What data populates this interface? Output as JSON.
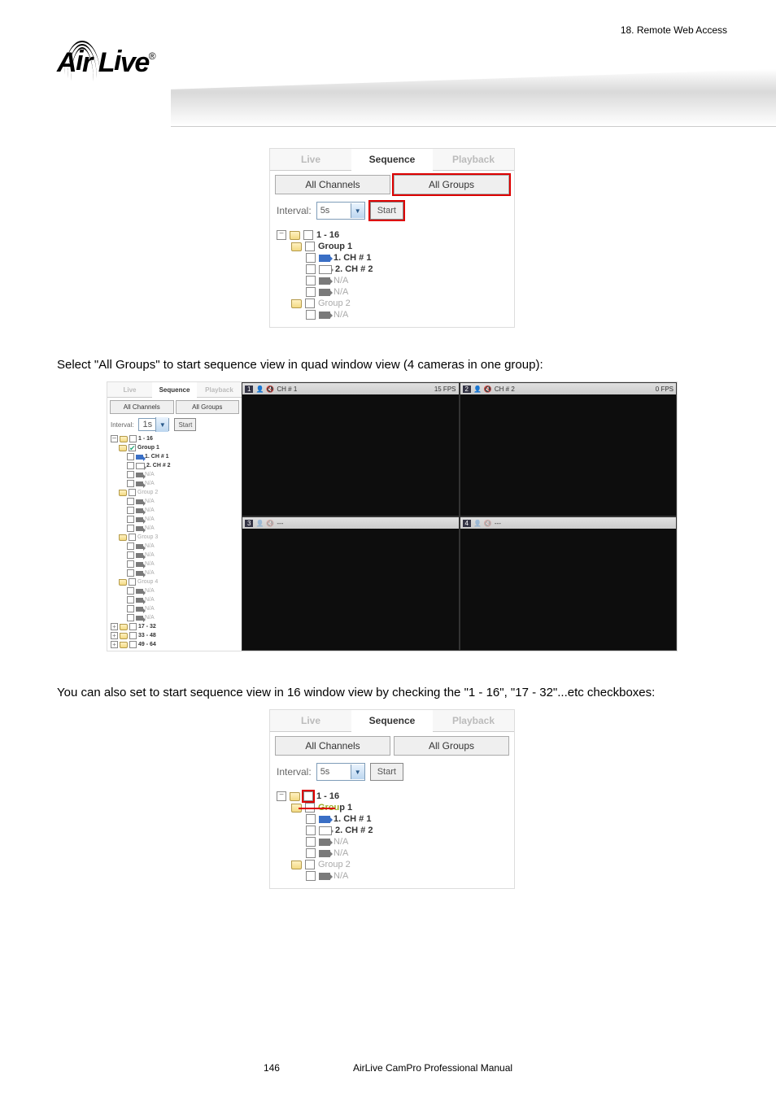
{
  "header": {
    "chapter": "18.  Remote  Web  Access",
    "logo_text": "Air Live"
  },
  "panel1": {
    "tab_live": "Live",
    "tab_sequence": "Sequence",
    "tab_playback": "Playback",
    "btn_all_channels": "All Channels",
    "btn_all_groups": "All Groups",
    "interval_label": "Interval:",
    "interval_value": "5s",
    "start_label": "Start",
    "tree": {
      "root": "1 - 16",
      "g1": "Group 1",
      "c1": "1. CH # 1",
      "c2": "2. CH # 2",
      "na": "N/A",
      "g2": "Group 2"
    }
  },
  "para1": "Select \"All Groups\" to start sequence view in quad window view (4 cameras in one group):",
  "mid": {
    "interval_value": "1s",
    "quad": {
      "ch1_label": "CH # 1",
      "ch1_fps": "15 FPS",
      "ch2_label": "CH # 2",
      "ch2_fps": "0 FPS",
      "ch3_label": "---",
      "ch4_label": "---",
      "n1": "1",
      "n2": "2",
      "n3": "3",
      "n4": "4"
    },
    "tree_extra": {
      "g2": "Group 2",
      "g3": "Group 3",
      "g4": "Group 4",
      "r2": "17 - 32",
      "r3": "33 - 48",
      "r4": "49 - 64"
    }
  },
  "para2": "You can also set to start sequence view in 16 window view by checking the \"1 - 16\", \"17 - 32\"...etc checkboxes:",
  "panel3": {
    "group_strike": "Group 1"
  },
  "footer": {
    "page": "146",
    "title": "AirLive  CamPro  Professional  Manual"
  }
}
